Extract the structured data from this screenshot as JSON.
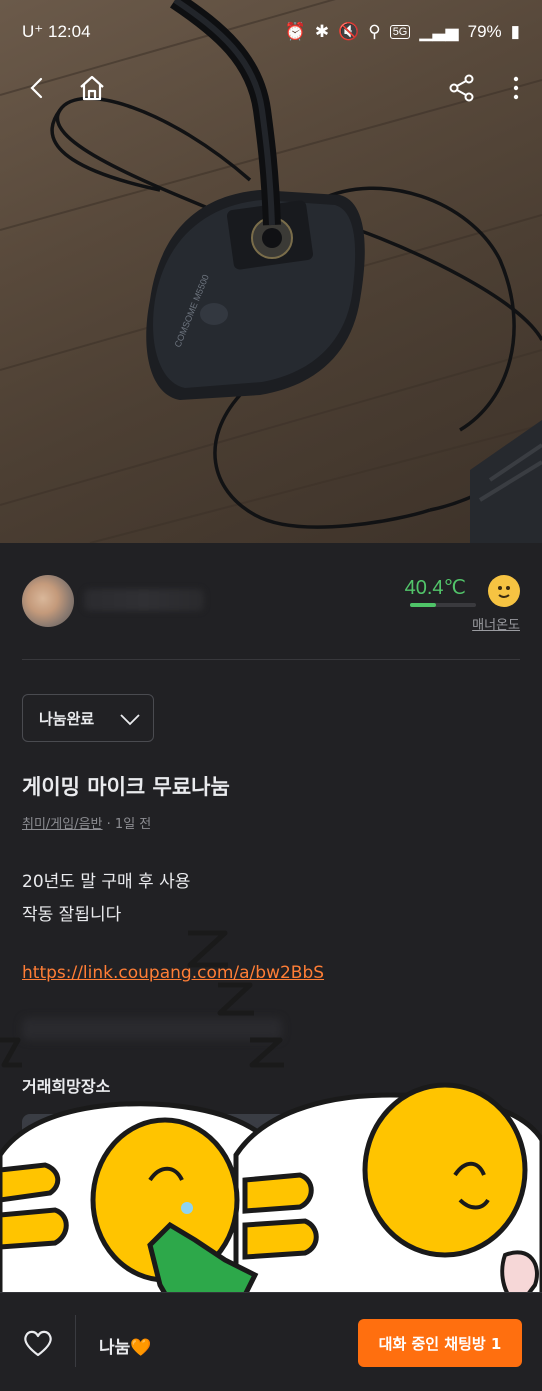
{
  "status_bar": {
    "carrier": "U⁺",
    "time": "12:04",
    "network": "5G",
    "battery": "79%"
  },
  "nav": {
    "back_icon": "back-arrow-icon",
    "home_icon": "home-icon",
    "share_icon": "share-icon",
    "more_icon": "more-vertical-icon"
  },
  "seller": {
    "temperature": "40.4℃",
    "temperature_level": 0.4,
    "manner_label": "매너온도"
  },
  "listing": {
    "status_select": "나눔완료",
    "title": "게이밍 마이크 무료나눔",
    "category": "취미/게임/음반",
    "time_ago": "· 1일 전",
    "body_line1": "20년도 말 구매 후 사용",
    "body_line2": "작동 잘됩니다",
    "link": "https://link.coupang.com/a/bw2BbS",
    "place_label": "거래희망장소"
  },
  "product_photo": {
    "brand": "COMSOME",
    "model": "M5500"
  },
  "bottom": {
    "price": "나눔🧡",
    "chat_button": "대화 중인 채팅방 1"
  },
  "colors": {
    "accent": "#ff6f0f",
    "link": "#ff7e36",
    "temperature": "#52c56a",
    "background": "#212124"
  }
}
